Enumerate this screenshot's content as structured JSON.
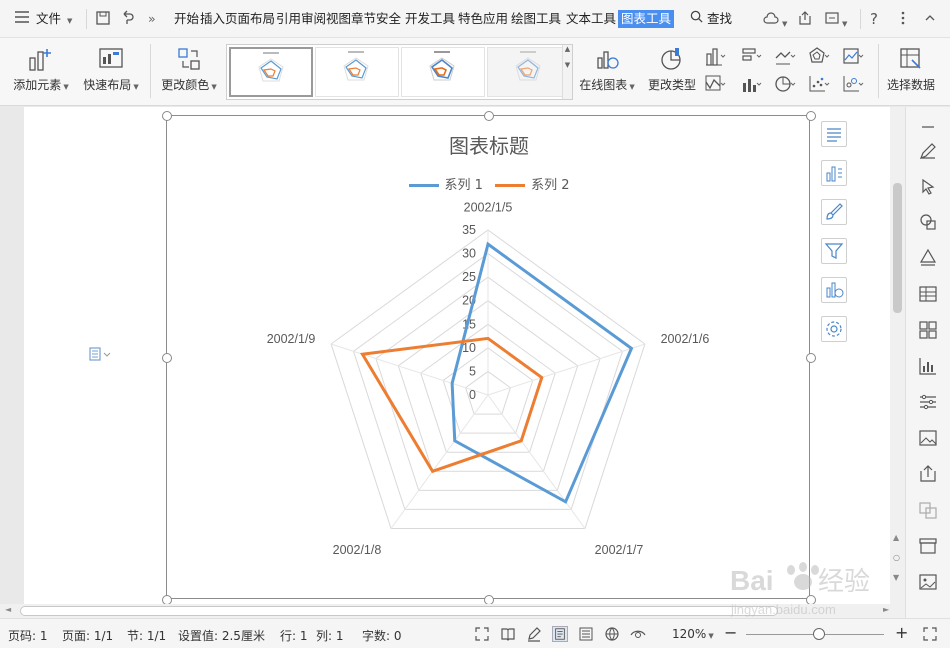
{
  "menubar": {
    "file_label": "文件",
    "tabs": [
      "开始",
      "插入",
      "页面布局",
      "引用",
      "审阅",
      "视图",
      "章节",
      "安全",
      "开发工具",
      "特色应用",
      "绘图工具",
      "文本工具",
      "图表工具"
    ],
    "active_tab": "图表工具",
    "search_label": "查找"
  },
  "ribbon": {
    "add_element": "添加元素",
    "quick_layout": "快速布局",
    "change_color": "更改颜色",
    "online_chart": "在线图表",
    "change_type": "更改类型",
    "select_data": "选择数据"
  },
  "chart": {
    "title": "图表标题",
    "legend": [
      {
        "name": "系列 1",
        "color": "#5b9bd5"
      },
      {
        "name": "系列 2",
        "color": "#ed7d31"
      }
    ]
  },
  "chart_data": {
    "type": "radar",
    "title": "图表标题",
    "categories": [
      "2002/1/5",
      "2002/1/6",
      "2002/1/7",
      "2002/1/8",
      "2002/1/9"
    ],
    "series": [
      {
        "name": "系列 1",
        "values": [
          32,
          32,
          28,
          12,
          8
        ],
        "color": "#5b9bd5"
      },
      {
        "name": "系列 2",
        "values": [
          12,
          12,
          12,
          20,
          28
        ],
        "color": "#ed7d31"
      }
    ],
    "ticks": [
      0,
      5,
      10,
      15,
      20,
      25,
      30,
      35
    ],
    "rlim": [
      0,
      35
    ],
    "legend": "top"
  },
  "status": {
    "page": "页码: 1",
    "pages": "页面: 1/1",
    "section": "节: 1/1",
    "setting": "设置值: 2.5厘米",
    "row": "行: 1",
    "col": "列: 1",
    "chars": "字数: 0",
    "zoom": "120%"
  },
  "watermark": {
    "brand": "Baidu 经验",
    "url": "jingyan.baidu.com"
  }
}
